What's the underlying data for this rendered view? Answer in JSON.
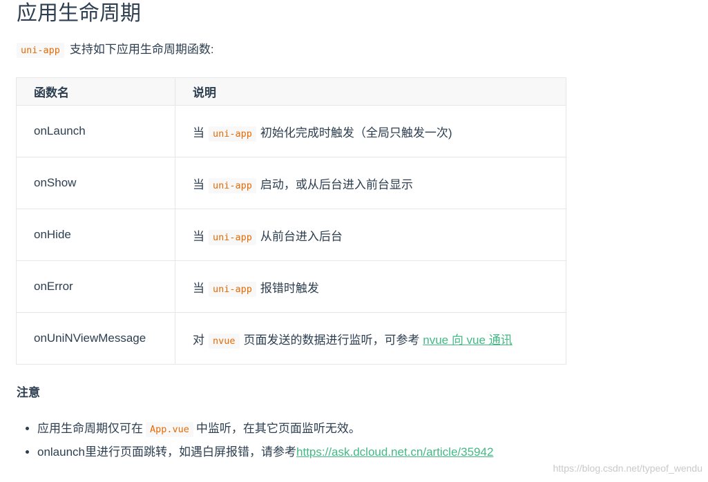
{
  "page": {
    "title": "应用生命周期"
  },
  "intro": {
    "code": "uni-app",
    "text": "支持如下应用生命周期函数:"
  },
  "table": {
    "headers": [
      "函数名",
      "说明"
    ],
    "rows": [
      {
        "name": "onLaunch",
        "prefix": "当",
        "code": "uni-app",
        "suffix": "初始化完成时触发（全局只触发一次)"
      },
      {
        "name": "onShow",
        "prefix": "当",
        "code": "uni-app",
        "suffix": "启动，或从后台进入前台显示"
      },
      {
        "name": "onHide",
        "prefix": "当",
        "code": "uni-app",
        "suffix": "从前台进入后台"
      },
      {
        "name": "onError",
        "prefix": "当",
        "code": "uni-app",
        "suffix": "报错时触发"
      },
      {
        "name": "onUniNViewMessage",
        "prefix": "对",
        "code": "nvue",
        "suffix": "页面发送的数据进行监听，可参考",
        "link": "nvue 向 vue 通讯"
      }
    ]
  },
  "notes": {
    "heading": "注意",
    "items": [
      {
        "before": "应用生命周期仅可在",
        "code": "App.vue",
        "after": "中监听，在其它页面监听无效。"
      },
      {
        "before": "onlaunch里进行页面跳转，如遇白屏报错，请参考",
        "link": "https://ask.dcloud.net.cn/article/35942"
      }
    ]
  },
  "watermark": "https://blog.csdn.net/typeof_wendu",
  "colors": {
    "code": "#e96900",
    "link": "#42b983",
    "text": "#2c3e50"
  }
}
